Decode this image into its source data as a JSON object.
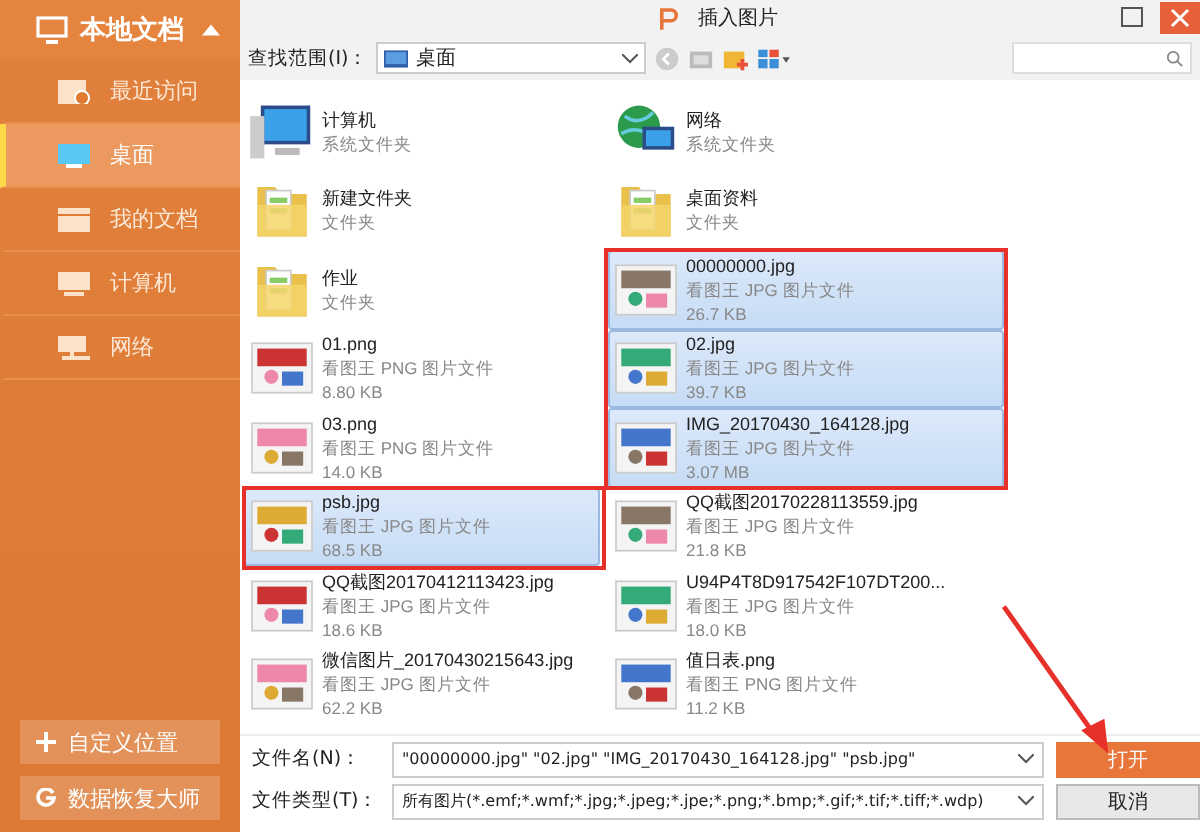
{
  "sidebar": {
    "title": "本地文档",
    "items": [
      {
        "label": "最近访问",
        "selected": false
      },
      {
        "label": "桌面",
        "selected": true
      },
      {
        "label": "我的文档",
        "selected": false
      },
      {
        "label": "计算机",
        "selected": false
      },
      {
        "label": "网络",
        "selected": false
      }
    ],
    "buttons": [
      {
        "label": "自定义位置"
      },
      {
        "label": "数据恢复大师"
      }
    ]
  },
  "window": {
    "title": "插入图片"
  },
  "toolbar": {
    "location_label": "查找范围(I)：",
    "location": "桌面"
  },
  "files": [
    {
      "name": "计算机",
      "type": "系统文件夹",
      "kind": "computer",
      "selected": false
    },
    {
      "name": "网络",
      "type": "系统文件夹",
      "kind": "network",
      "selected": false
    },
    {
      "name": "新建文件夹",
      "type": "文件夹",
      "kind": "folder",
      "selected": false
    },
    {
      "name": "桌面资料",
      "type": "文件夹",
      "kind": "folder",
      "selected": false
    },
    {
      "name": "作业",
      "type": "文件夹",
      "kind": "folder",
      "selected": false
    },
    {
      "name": "00000000.jpg",
      "type": "看图王 JPG 图片文件",
      "size": "26.7 KB",
      "selected": true
    },
    {
      "name": "01.png",
      "type": "看图王 PNG 图片文件",
      "size": "8.80 KB",
      "selected": false
    },
    {
      "name": "02.jpg",
      "type": "看图王 JPG 图片文件",
      "size": "39.7 KB",
      "selected": true
    },
    {
      "name": "03.png",
      "type": "看图王 PNG 图片文件",
      "size": "14.0 KB",
      "selected": false
    },
    {
      "name": "IMG_20170430_164128.jpg",
      "type": "看图王 JPG 图片文件",
      "size": "3.07 MB",
      "selected": true
    },
    {
      "name": "psb.jpg",
      "type": "看图王 JPG 图片文件",
      "size": "68.5 KB",
      "selected": true
    },
    {
      "name": "QQ截图20170228113559.jpg",
      "type": "看图王 JPG 图片文件",
      "size": "21.8 KB",
      "selected": false
    },
    {
      "name": "QQ截图20170412113423.jpg",
      "type": "看图王 JPG 图片文件",
      "size": "18.6 KB",
      "selected": false
    },
    {
      "name": "U94P4T8D917542F107DT200...",
      "type": "看图王 JPG 图片文件",
      "size": "18.0 KB",
      "selected": false
    },
    {
      "name": "微信图片_20170430215643.jpg",
      "type": "看图王 JPG 图片文件",
      "size": "62.2 KB",
      "selected": false
    },
    {
      "name": "值日表.png",
      "type": "看图王 PNG 图片文件",
      "size": "11.2 KB",
      "selected": false
    }
  ],
  "filename": {
    "label": "文件名(N)：",
    "value": "\"00000000.jpg\" \"02.jpg\" \"IMG_20170430_164128.jpg\" \"psb.jpg\""
  },
  "filetype": {
    "label": "文件类型(T)：",
    "value": "所有图片(*.emf;*.wmf;*.jpg;*.jpeg;*.jpe;*.png;*.bmp;*.gif;*.tif;*.tiff;*.wdp)"
  },
  "buttons": [
    {
      "label": "打开",
      "kind": "primary"
    },
    {
      "label": "取消",
      "kind": "normal"
    }
  ]
}
